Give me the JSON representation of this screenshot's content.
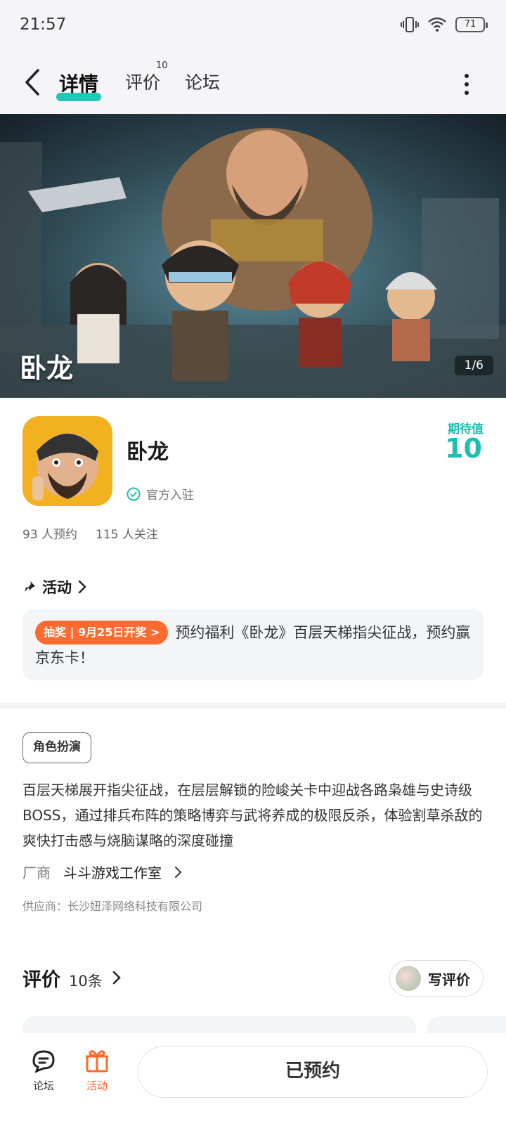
{
  "status_bar": {
    "time": "21:57",
    "battery": "71"
  },
  "nav": {
    "tabs": [
      {
        "label": "详情",
        "active": true
      },
      {
        "label": "评价",
        "badge": "10"
      },
      {
        "label": "论坛"
      }
    ]
  },
  "banner": {
    "title_art": "卧龙",
    "pager": "1/6"
  },
  "app": {
    "name": "卧龙",
    "verified_label": "官方入驻",
    "expect_label": "期待值",
    "expect_value": "10",
    "reservations": "93 人预约",
    "followers": "115 人关注"
  },
  "activity": {
    "heading": "活动",
    "badge": "抽奖 | 9月25日开奖 >",
    "text": "预约福利《卧龙》百层天梯指尖征战，预约赢京东卡！"
  },
  "details": {
    "genre": "角色扮演",
    "description": "百层天梯展开指尖征战，在层层解锁的险峻关卡中迎战各路枭雄与史诗级BOSS，通过排兵布阵的策略博弈与武将养成的极限反杀，体验割草杀敌的爽快打击感与烧脑谋略的深度碰撞",
    "vendor_label": "厂商",
    "vendor_name": "斗斗游戏工作室",
    "supplier": "供应商：长沙妞泽网络科技有限公司"
  },
  "reviews": {
    "title": "评价",
    "count": "10条",
    "write_label": "写评价"
  },
  "bottom_bar": {
    "forum_label": "论坛",
    "activity_label": "活动",
    "primary_button": "已预约"
  },
  "colors": {
    "accent": "#19bfb0",
    "orange": "#ff6a2e"
  }
}
